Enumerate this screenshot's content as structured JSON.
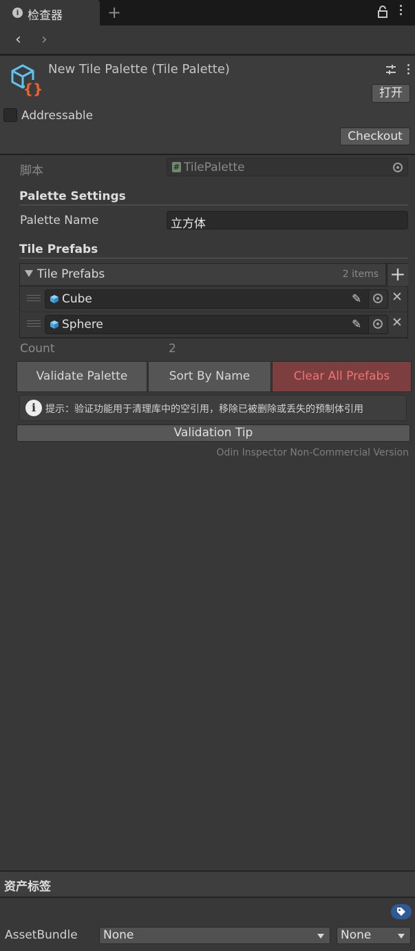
{
  "tab": {
    "title": "检查器",
    "add": "+"
  },
  "nav": {
    "back": "‹",
    "forward": "›"
  },
  "header": {
    "title": "New Tile Palette (Tile Palette)",
    "open_button": "打开",
    "addressable_label": "Addressable",
    "addressable_checked": false,
    "checkout_button": "Checkout"
  },
  "script": {
    "label": "脚本",
    "value": "TilePalette"
  },
  "palette_settings": {
    "title": "Palette Settings",
    "name_label": "Palette Name",
    "name_value": "立方体"
  },
  "tile_prefabs": {
    "section_title": "Tile Prefabs",
    "list_title": "Tile Prefabs",
    "count_text": "2 items",
    "add": "+",
    "items": [
      {
        "name": "Cube"
      },
      {
        "name": "Sphere"
      }
    ],
    "count_label": "Count",
    "count_value": "2"
  },
  "actions": {
    "validate": "Validate Palette",
    "sort": "Sort By Name",
    "clear": "Clear All Prefabs"
  },
  "info": {
    "icon": "i",
    "text": "提示：验证功能用于清理库中的空引用，移除已被删除或丢失的预制体引用"
  },
  "validation_tip_button": "Validation Tip",
  "odin_notice": "Odin Inspector Non-Commercial Version",
  "asset_labels": {
    "title": "资产标签",
    "assetbundle_label": "AssetBundle",
    "bundle_value": "None",
    "variant_value": "None"
  },
  "icons": {
    "tab": "info-icon",
    "lock": "lock-icon",
    "asset": "tile-palette-asset-icon",
    "settings": "preset-settings-icon",
    "tag": "tag-icon"
  },
  "colors": {
    "background": "#383838",
    "tabbar": "#191919",
    "danger_bg": "#7c3e3e",
    "danger_text": "#f07474",
    "icon_blue": "#5fc3ef",
    "icon_orange": "#f0612e",
    "tag_badge": "#2f5a97"
  }
}
